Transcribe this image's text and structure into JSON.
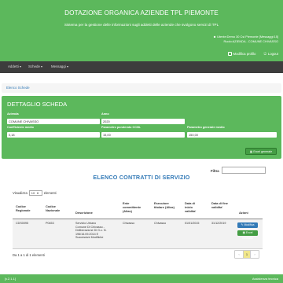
{
  "header": {
    "title": "DOTAZIONE ORGANICA AZIENDE TPL PIEMONTE",
    "subtitle": "Sistema per la gestione delle informazioni sugli addetti delle aziende che svolgono servizi di TPL",
    "user_line": "Utente:Demo 30 Csi Piemonte [Messaggi:15]",
    "role_line": "Ruolo:AZIENDA - COMUNE CHIVASSO",
    "modify_profile": "Modifica profilo",
    "logout": "Logout"
  },
  "navbar": {
    "items": [
      {
        "label": "Addetti"
      },
      {
        "label": "Schede"
      },
      {
        "label": "Messaggi"
      }
    ]
  },
  "breadcrumb": {
    "label": "Elenco Schede"
  },
  "detail": {
    "title": "DETTAGLIO SCHEDA",
    "fields": {
      "azienda_label": "Azienda",
      "azienda_value": "COMUNE CHIVASSO",
      "anno_label": "Anno",
      "anno_value": "2020",
      "coeff_label": "Coefficiente medio",
      "coeff_value": "0,18",
      "param_ccnl_label": "Parametro ponderato CCNL",
      "param_ccnl_value": "15,00",
      "param_gen_label": "Parametro generale medio",
      "param_gen_value": "150,00"
    },
    "excel_button": "Excel generale"
  },
  "filter": {
    "label": "Filtra"
  },
  "contracts": {
    "title": "ELENCO CONTRATTI DI SERVIZIO",
    "show_prefix": "Visualizza",
    "show_value": "10",
    "show_suffix": "elementi",
    "headers": {
      "codice_regionale": "Codice Regionale",
      "codice_nazionale": "Codice Nazionale",
      "descrizione": "Descrizione",
      "ente": "Ente committente (Alias)",
      "esecutore": "Esecutore titolare (Alias)",
      "data_inizio": "Data di inizio validita'",
      "data_fine": "Data di fine validita'",
      "azioni": "Azioni"
    },
    "rows": [
      {
        "codice_regionale": "CDS0095",
        "codice_nazionale": "P0453",
        "descrizione_lines": [
          "Servizio Urbano",
          "Comune Di Chivasso -",
          "Deliberazione Di G.c. N.",
          "196/16.09.2014 E",
          "Successive Modifiche"
        ],
        "ente": "Chivasso",
        "esecutore": "Chivasso",
        "data_inizio": "01/01/2015",
        "data_fine": "31/12/2019",
        "action_modify": "Modifica",
        "action_excel": "Excel contratto"
      }
    ],
    "info": "Da 1 a 1 di 1 elementi",
    "pager": {
      "prev": "‹",
      "current": "1",
      "next": "›"
    }
  },
  "footer": {
    "version": "[v.2.1.1]",
    "assistance": "Assistenza tecnica"
  },
  "colors": {
    "green": "#5cb85c",
    "dark_nav": "#3d3d3d",
    "blue_title": "#337ab7",
    "modify_blue": "#337ab7",
    "excel_green": "#449d44"
  }
}
